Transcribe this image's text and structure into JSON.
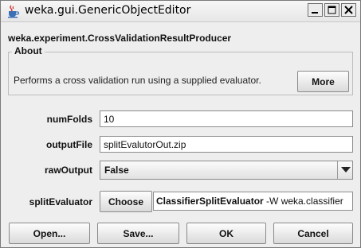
{
  "window": {
    "title": "weka.gui.GenericObjectEditor",
    "controls": {
      "minimize_icon": "minimize-icon",
      "maximize_icon": "maximize-icon",
      "close_icon": "close-icon"
    }
  },
  "editor": {
    "class_name": "weka.experiment.CrossValidationResultProducer",
    "about": {
      "title": "About",
      "description": "Performs a cross validation run using a supplied evaluator.",
      "more_label": "More"
    },
    "properties": {
      "num_folds": {
        "label": "numFolds",
        "value": "10"
      },
      "output_file": {
        "label": "outputFile",
        "value": "splitEvalutorOut.zip"
      },
      "raw_output": {
        "label": "rawOutput",
        "value": "False"
      },
      "split_evaluator": {
        "label": "splitEvaluator",
        "choose_label": "Choose",
        "value_bold": "ClassifierSplitEvaluator",
        "value_rest": " -W weka.classifier"
      }
    }
  },
  "buttons": {
    "open": "Open...",
    "save": "Save...",
    "ok": "OK",
    "cancel": "Cancel"
  },
  "colors": {
    "title_bar": "#ececec",
    "window_bg": "#eeeeee",
    "field_bg": "#ffffff",
    "border": "#8c8c8c"
  }
}
